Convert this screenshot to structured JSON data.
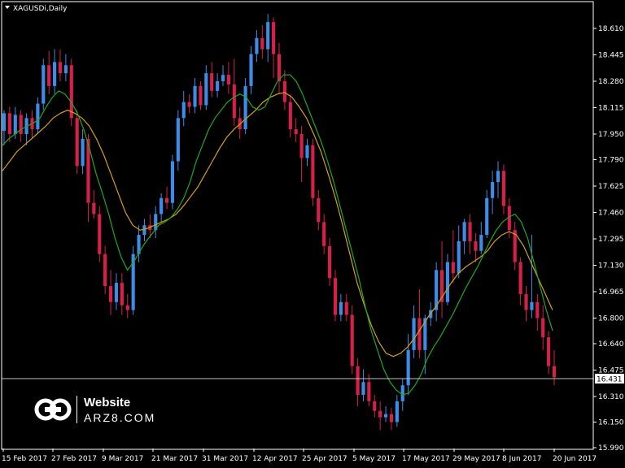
{
  "chart_title": "XAGUSDi,Daily",
  "watermark": {
    "line1": "Website",
    "line2": "ARZ8.COM"
  },
  "colors": {
    "background": "#000000",
    "bull": "#3d8de8",
    "bear": "#d6204a",
    "ma_fast": "#1fa81f",
    "ma_slow": "#d4a017",
    "axis": "#ffffff",
    "price_line": "#c0c0c0"
  },
  "chart_data": {
    "type": "candlestick",
    "title": "XAGUSDi,Daily",
    "ylim": [
      15.99,
      18.73
    ],
    "y_ticks": [
      "18.610",
      "18.445",
      "18.280",
      "18.115",
      "17.950",
      "17.790",
      "17.625",
      "17.460",
      "17.295",
      "17.130",
      "16.965",
      "16.800",
      "16.640",
      "16.475",
      "16.310",
      "16.150",
      "15.990"
    ],
    "x_ticks": [
      "15 Feb 2017",
      "27 Feb 2017",
      "9 Mar 2017",
      "21 Mar 2017",
      "31 Mar 2017",
      "12 Apr 2017",
      "25 Apr 2017",
      "5 May 2017",
      "17 May 2017",
      "29 May 2017",
      "8 Jun 2017",
      "20 Jun 2017"
    ],
    "current_price": "16.431",
    "candles": [
      [
        17.97,
        18.08,
        17.88,
        18.1
      ],
      [
        18.08,
        17.95,
        17.9,
        18.12
      ],
      [
        17.95,
        18.07,
        17.92,
        18.12
      ],
      [
        18.07,
        17.95,
        17.9,
        18.1
      ],
      [
        17.95,
        18.05,
        17.88,
        18.08
      ],
      [
        18.05,
        17.98,
        17.92,
        18.1
      ],
      [
        17.98,
        18.14,
        17.95,
        18.18
      ],
      [
        18.14,
        18.38,
        18.1,
        18.42
      ],
      [
        18.38,
        18.25,
        18.2,
        18.47
      ],
      [
        18.25,
        18.4,
        18.2,
        18.48
      ],
      [
        18.4,
        18.33,
        18.28,
        18.48
      ],
      [
        18.33,
        18.38,
        18.28,
        18.45
      ],
      [
        18.38,
        18.05,
        18.0,
        18.42
      ],
      [
        18.05,
        17.75,
        17.7,
        18.1
      ],
      [
        17.75,
        17.92,
        17.7,
        17.98
      ],
      [
        17.92,
        17.52,
        17.4,
        17.95
      ],
      [
        17.52,
        17.45,
        17.42,
        17.6
      ],
      [
        17.45,
        17.2,
        17.15,
        17.5
      ],
      [
        17.2,
        17.0,
        16.95,
        17.25
      ],
      [
        17.0,
        16.9,
        16.82,
        17.1
      ],
      [
        16.9,
        17.02,
        16.85,
        17.08
      ],
      [
        17.02,
        16.88,
        16.82,
        17.08
      ],
      [
        16.88,
        16.85,
        16.8,
        16.95
      ],
      [
        16.85,
        17.2,
        16.82,
        17.25
      ],
      [
        17.2,
        17.32,
        17.15,
        17.38
      ],
      [
        17.32,
        17.38,
        17.28,
        17.42
      ],
      [
        17.38,
        17.35,
        17.3,
        17.45
      ],
      [
        17.35,
        17.45,
        17.3,
        17.5
      ],
      [
        17.45,
        17.55,
        17.4,
        17.58
      ],
      [
        17.55,
        17.52,
        17.48,
        17.62
      ],
      [
        17.52,
        17.78,
        17.48,
        17.82
      ],
      [
        17.78,
        18.05,
        17.72,
        18.1
      ],
      [
        18.05,
        18.15,
        18.0,
        18.22
      ],
      [
        18.15,
        18.12,
        18.08,
        18.2
      ],
      [
        18.12,
        18.25,
        18.08,
        18.3
      ],
      [
        18.25,
        18.13,
        18.1,
        18.28
      ],
      [
        18.13,
        18.33,
        18.1,
        18.38
      ],
      [
        18.33,
        18.22,
        18.18,
        18.4
      ],
      [
        18.22,
        18.28,
        18.18,
        18.33
      ],
      [
        18.28,
        18.32,
        18.25,
        18.38
      ],
      [
        18.32,
        18.26,
        18.2,
        18.4
      ],
      [
        18.26,
        18.05,
        18.0,
        18.42
      ],
      [
        18.05,
        17.98,
        17.92,
        18.12
      ],
      [
        17.98,
        18.25,
        17.95,
        18.3
      ],
      [
        18.25,
        18.45,
        18.2,
        18.5
      ],
      [
        18.45,
        18.55,
        18.4,
        18.6
      ],
      [
        18.55,
        18.48,
        18.42,
        18.63
      ],
      [
        18.48,
        18.65,
        18.4,
        18.7
      ],
      [
        18.65,
        18.45,
        18.3,
        18.68
      ],
      [
        18.45,
        18.28,
        18.2,
        18.52
      ],
      [
        18.28,
        18.15,
        18.1,
        18.35
      ],
      [
        18.15,
        17.98,
        17.93,
        18.2
      ],
      [
        17.98,
        17.95,
        17.9,
        18.05
      ],
      [
        17.95,
        17.8,
        17.65,
        18.0
      ],
      [
        17.8,
        17.88,
        17.75,
        17.92
      ],
      [
        17.88,
        17.55,
        17.5,
        17.92
      ],
      [
        17.55,
        17.4,
        17.35,
        17.6
      ],
      [
        17.4,
        17.25,
        17.2,
        17.45
      ],
      [
        17.25,
        17.05,
        17.0,
        17.3
      ],
      [
        17.05,
        16.82,
        16.78,
        17.1
      ],
      [
        16.82,
        16.9,
        16.78,
        16.95
      ],
      [
        16.9,
        16.82,
        16.78,
        16.95
      ],
      [
        16.82,
        16.5,
        16.45,
        16.88
      ],
      [
        16.5,
        16.32,
        16.25,
        16.55
      ],
      [
        16.32,
        16.4,
        16.28,
        16.48
      ],
      [
        16.4,
        16.28,
        16.25,
        16.45
      ],
      [
        16.28,
        16.22,
        16.18,
        16.32
      ],
      [
        16.22,
        16.18,
        16.1,
        16.28
      ],
      [
        16.18,
        16.2,
        16.15,
        16.25
      ],
      [
        16.2,
        16.15,
        16.1,
        16.24
      ],
      [
        16.15,
        16.28,
        16.12,
        16.32
      ],
      [
        16.28,
        16.38,
        16.22,
        16.42
      ],
      [
        16.38,
        16.6,
        16.32,
        16.7
      ],
      [
        16.6,
        16.8,
        16.55,
        16.88
      ],
      [
        16.8,
        16.6,
        16.55,
        16.98
      ],
      [
        16.6,
        16.8,
        16.45,
        16.82
      ],
      [
        16.8,
        16.85,
        16.75,
        16.9
      ],
      [
        16.85,
        17.1,
        16.78,
        17.15
      ],
      [
        17.1,
        16.9,
        16.8,
        17.28
      ],
      [
        16.9,
        17.15,
        16.88,
        17.2
      ],
      [
        17.15,
        17.08,
        17.02,
        17.35
      ],
      [
        17.08,
        17.28,
        17.05,
        17.38
      ],
      [
        17.28,
        17.4,
        17.2,
        17.42
      ],
      [
        17.4,
        17.28,
        17.2,
        17.45
      ],
      [
        17.28,
        17.22,
        17.15,
        17.33
      ],
      [
        17.22,
        17.32,
        17.2,
        17.4
      ],
      [
        17.32,
        17.55,
        17.3,
        17.6
      ],
      [
        17.55,
        17.65,
        17.45,
        17.72
      ],
      [
        17.65,
        17.72,
        17.55,
        17.78
      ],
      [
        17.72,
        17.5,
        17.45,
        17.76
      ],
      [
        17.5,
        17.35,
        17.3,
        17.55
      ],
      [
        17.35,
        17.15,
        17.1,
        17.4
      ],
      [
        17.15,
        16.95,
        16.88,
        17.18
      ],
      [
        16.95,
        16.85,
        16.78,
        17.0
      ],
      [
        16.85,
        16.9,
        16.8,
        17.32
      ],
      [
        16.9,
        16.8,
        16.72,
        16.95
      ],
      [
        16.8,
        16.68,
        16.6,
        16.88
      ],
      [
        16.68,
        16.5,
        16.45,
        16.72
      ],
      [
        16.5,
        16.43,
        16.38,
        16.6
      ]
    ],
    "ma_fast": [
      17.88,
      17.92,
      17.95,
      17.98,
      18.0,
      18.02,
      18.05,
      18.12,
      18.18,
      18.22,
      18.2,
      18.15,
      18.08,
      17.98,
      17.85,
      17.7,
      17.58,
      17.45,
      17.3,
      17.18,
      17.1,
      17.15,
      17.22,
      17.28,
      17.33,
      17.38,
      17.4,
      17.43,
      17.48,
      17.55,
      17.65,
      17.78,
      17.88,
      17.98,
      18.05,
      18.1,
      18.15,
      18.18,
      18.2,
      18.18,
      18.12,
      18.1,
      18.12,
      18.2,
      18.28,
      18.32,
      18.32,
      18.28,
      18.2,
      18.1,
      18.0,
      17.9,
      17.78,
      17.65,
      17.5,
      17.35,
      17.2,
      17.05,
      16.88,
      16.72,
      16.6,
      16.48,
      16.4,
      16.35,
      16.32,
      16.33,
      16.38,
      16.45,
      16.55,
      16.62,
      16.68,
      16.75,
      16.82,
      16.9,
      16.98,
      17.05,
      17.12,
      17.2,
      17.28,
      17.35,
      17.4,
      17.43,
      17.45,
      17.4,
      17.3,
      17.15,
      17.0,
      16.85,
      16.72
    ],
    "ma_slow": [
      17.72,
      17.78,
      17.84,
      17.88,
      17.92,
      17.96,
      18.0,
      18.05,
      18.08,
      18.1,
      18.08,
      18.05,
      18.0,
      17.92,
      17.82,
      17.7,
      17.58,
      17.46,
      17.38,
      17.35,
      17.36,
      17.38,
      17.4,
      17.42,
      17.45,
      17.5,
      17.56,
      17.62,
      17.7,
      17.78,
      17.86,
      17.93,
      17.98,
      18.02,
      18.06,
      18.1,
      18.15,
      18.18,
      18.2,
      18.21,
      18.18,
      18.12,
      18.05,
      17.95,
      17.84,
      17.7,
      17.55,
      17.38,
      17.2,
      17.02,
      16.88,
      16.75,
      16.65,
      16.58,
      16.56,
      16.58,
      16.62,
      16.68,
      16.75,
      16.82,
      16.88,
      16.95,
      17.02,
      17.08,
      17.12,
      17.15,
      17.18,
      17.22,
      17.28,
      17.32,
      17.34,
      17.32,
      17.25,
      17.15,
      17.05,
      16.95,
      16.85
    ]
  }
}
